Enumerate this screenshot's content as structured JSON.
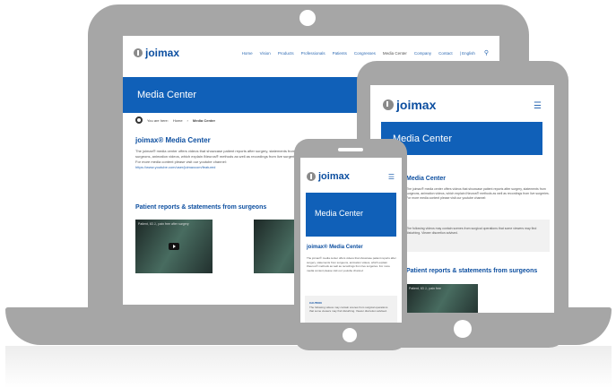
{
  "brand": {
    "logo": "joimax",
    "accent": "#1060b8",
    "frame": "#a6a6a6"
  },
  "laptop": {
    "nav": [
      "Home",
      "Vision",
      "Products",
      "Professionals",
      "Patients",
      "Congresses",
      "Media Center",
      "Company",
      "Contact",
      "| English"
    ],
    "hero": "Media Center",
    "breadcrumb": {
      "intro": "You are here:",
      "home": "Home",
      "current": "Media Center"
    },
    "heading": "joimax® Media Center",
    "text": "The joimax® media center offers videos that showcase patient reports after surgery, statements from surgeons, animation videos, which explain iNeuros® methods as well as recordings from live surgeries. For more media content please visit our youtube channel:",
    "link": "https://www.youtube.com/user/joimaxcom/featured",
    "section": "Patient reports & statements from surgeons",
    "videos": [
      {
        "title": "Patient, 63 J., pain free after surgery"
      },
      {
        "title": ""
      }
    ]
  },
  "tablet": {
    "menu_icon": "hamburger-icon",
    "hero": "Media Center",
    "heading": "Media Center",
    "text": "The joimax® media center offers videos that showcase patient reports after surgery, statements from surgeons, animation videos, which explain iNeuros® methods as well as recordings from live surgeries. For more media content please visit our youtube channel:",
    "note": "The following videos may contain scenes from surgical operations that some viewers may find disturbing. Viewer discretion advised.",
    "section": "Patient reports & statements from surgeons",
    "video_title": "Patient, 63 J., pain free"
  },
  "phone": {
    "menu_icon": "hamburger-icon",
    "hero": "Media Center",
    "heading": "joimax® Media Center",
    "text": "The joimax® media center offers videos that showcase patient reports after surgery, statements from surgeons, animation videos, which explain iNeuros® methods as well as recordings from live surgeries. For more media content please visit our youtube channel:",
    "note_title": "CAUTION",
    "note": "The following videos may contain scenes from surgical operations that some viewers may find disturbing. Viewer discretion advised."
  }
}
